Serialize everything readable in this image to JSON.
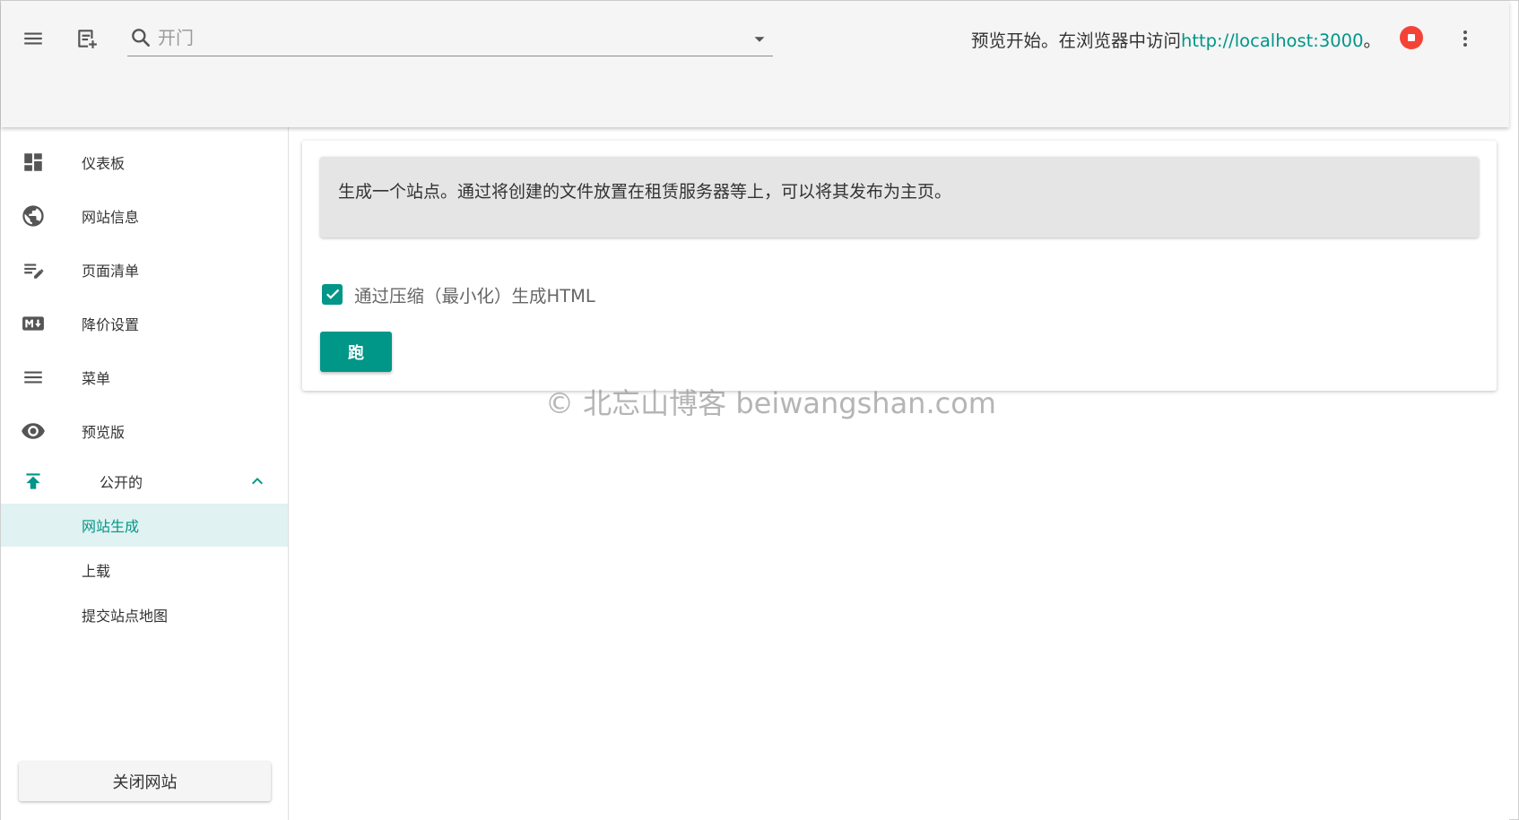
{
  "header": {
    "search_placeholder": "开门",
    "preview_status_prefix": "预览开始。在浏览器中访问",
    "preview_url": "http://localhost:3000",
    "preview_status_suffix": "。"
  },
  "sidebar": {
    "items": [
      {
        "label": "仪表板",
        "icon": "dashboard-icon"
      },
      {
        "label": "网站信息",
        "icon": "globe-icon"
      },
      {
        "label": "页面清单",
        "icon": "edit-list-icon"
      },
      {
        "label": "降价设置",
        "icon": "markdown-icon"
      },
      {
        "label": "菜单",
        "icon": "menu-icon"
      },
      {
        "label": "预览版",
        "icon": "eye-icon"
      }
    ],
    "publish_group": {
      "label": "公开的",
      "icon": "publish-icon",
      "subitems": [
        {
          "label": "网站生成",
          "active": true
        },
        {
          "label": "上载",
          "active": false
        },
        {
          "label": "提交站点地图",
          "active": false
        }
      ]
    },
    "close_site_label": "关闭网站"
  },
  "main": {
    "info_text": "生成一个站点。通过将创建的文件放置在租赁服务器等上，可以将其发布为主页。",
    "minify_checkbox": {
      "label": "通过压缩（最小化）生成HTML",
      "checked": true
    },
    "run_button": "跑"
  },
  "watermark": "© 北忘山博客 beiwangshan.com",
  "colors": {
    "accent": "#009688",
    "stop_button": "#f44336",
    "topbar_bg": "#f5f5f5",
    "info_bg": "#e5e5e5",
    "active_item_bg": "#e0f2f1"
  }
}
